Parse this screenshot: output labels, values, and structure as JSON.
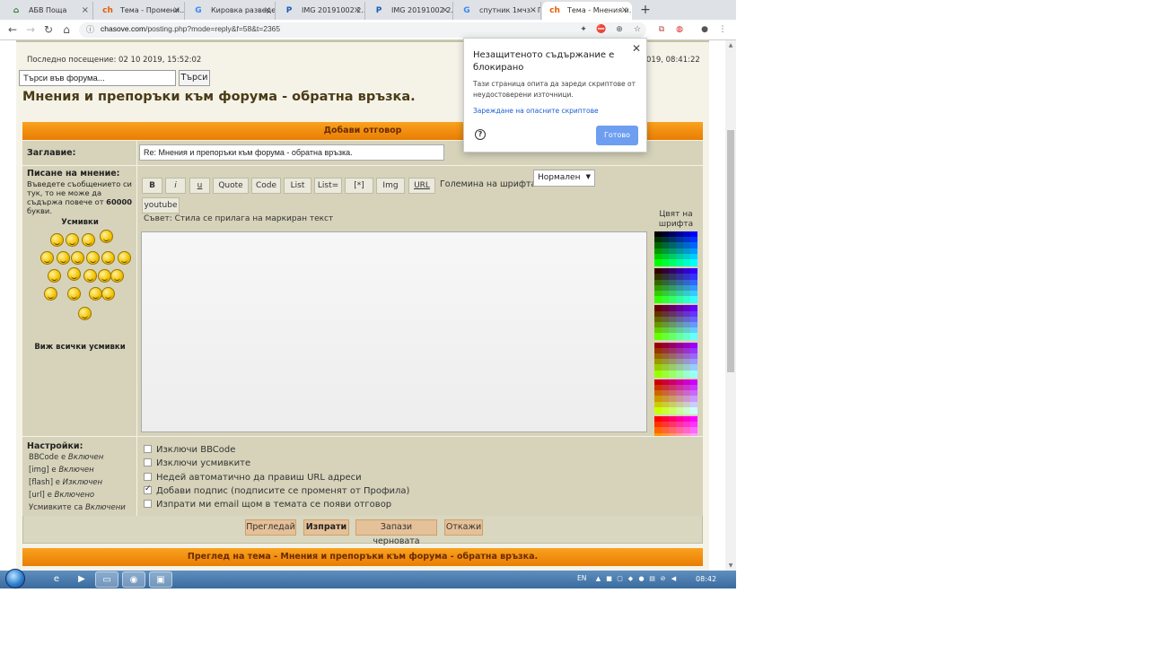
{
  "browser": {
    "tabs": [
      {
        "title": "АБВ Поща",
        "icon": "home-icon",
        "fav": "⌂",
        "fav_color": "#2f7d32"
      },
      {
        "title": "Тема - Промени...",
        "icon": "chasove-ch-icon",
        "fav": "ch",
        "fav_color": "#e65c00"
      },
      {
        "title": "Кировка разведени...",
        "icon": "google-icon",
        "fav": "G",
        "fav_color": "#4285f4"
      },
      {
        "title": "IMG 20191002 2...",
        "icon": "image-p-icon",
        "fav": "P",
        "fav_color": "#1e5bb5"
      },
      {
        "title": "IMG 20191002 2...",
        "icon": "image-p-icon",
        "fav": "P",
        "fav_color": "#1e5bb5"
      },
      {
        "title": "спутник 1мчз - Го...",
        "icon": "google-icon",
        "fav": "G",
        "fav_color": "#4285f4"
      },
      {
        "title": "Тема - Мнения и...",
        "icon": "chasove-ch-icon",
        "fav": "ch",
        "fav_color": "#e65c00",
        "active": true
      }
    ],
    "new_tab": "+",
    "url_host": "chasove.com",
    "url_path": "/posting.php?mode=reply&f=58&t=2365"
  },
  "page": {
    "last_visit": "Последно посещение: 02 10 2019, 15:52:02",
    "current_time": "019, 08:41:22",
    "search_placeholder": "Търси във форума...",
    "search_button": "Търси",
    "title": "Мнения и препоръки към форума - обратна връзка.",
    "reply_header": "Добави отговор",
    "subject_label": "Заглавие:",
    "subject_value": "Re: Мнения и препоръки към форума - обратна връзка.",
    "message_label": "Писане на мнение:",
    "message_help_1": "Въведете съобщението си тук, то не може да съдържа повече от ",
    "message_help_count": "60000",
    "message_help_2": " букви.",
    "smilies_title": "Усмивки",
    "all_smilies": "Виж всички усмивки",
    "format_buttons": [
      "B",
      "i",
      "u",
      "Quote",
      "Code",
      "List",
      "List=",
      "[*]",
      "Img",
      "URL"
    ],
    "youtube_button": "youtube",
    "font_size_label": "Големина на шрифта:",
    "font_size_value": "Нормален",
    "tip": "Съвет: Стила се прилага на маркиран текст",
    "color_title_1": "Цвят на",
    "color_title_2": "шрифта",
    "settings_label": "Настройки:",
    "settings": [
      {
        "name": "BBCode",
        "mid": " е ",
        "state": "Включен"
      },
      {
        "name": "[img]",
        "mid": " е ",
        "state": "Включен"
      },
      {
        "name": "[flash]",
        "mid": " е ",
        "state": "Изключен"
      },
      {
        "name": "[url]",
        "mid": " е ",
        "state": "Включено"
      },
      {
        "name": "Усмивките",
        "mid": " са ",
        "state": "Включени"
      }
    ],
    "options": [
      {
        "label": "Изключи BBCode",
        "checked": false
      },
      {
        "label": "Изключи усмивките",
        "checked": false
      },
      {
        "label": "Недей автоматично да правиш URL адреси",
        "checked": false
      },
      {
        "label": "Добави подпис (подписите се променят от Профила)",
        "checked": true
      },
      {
        "label": "Изпрати ми email щом в темата се появи отговор",
        "checked": false
      }
    ],
    "submit_buttons": [
      "Прегледай",
      "Изпрати",
      "Запази черновата",
      "Откажи"
    ],
    "preview_header": "Преглед на тема - Мнения и препоръки към форума - обратна връзка."
  },
  "popup": {
    "title": "Незащитеното съдържание е блокирано",
    "body": "Тази страница опита да зареди скриптове от неудостоверени източници.",
    "link": "Зареждане на опасните скриптове",
    "done": "Готово"
  },
  "taskbar": {
    "lang": "EN",
    "clock": "08:42"
  },
  "colors": {
    "accent_orange": "#f39212",
    "form_bg": "#d6d3ba",
    "popup_button": "#6d9ef0"
  }
}
